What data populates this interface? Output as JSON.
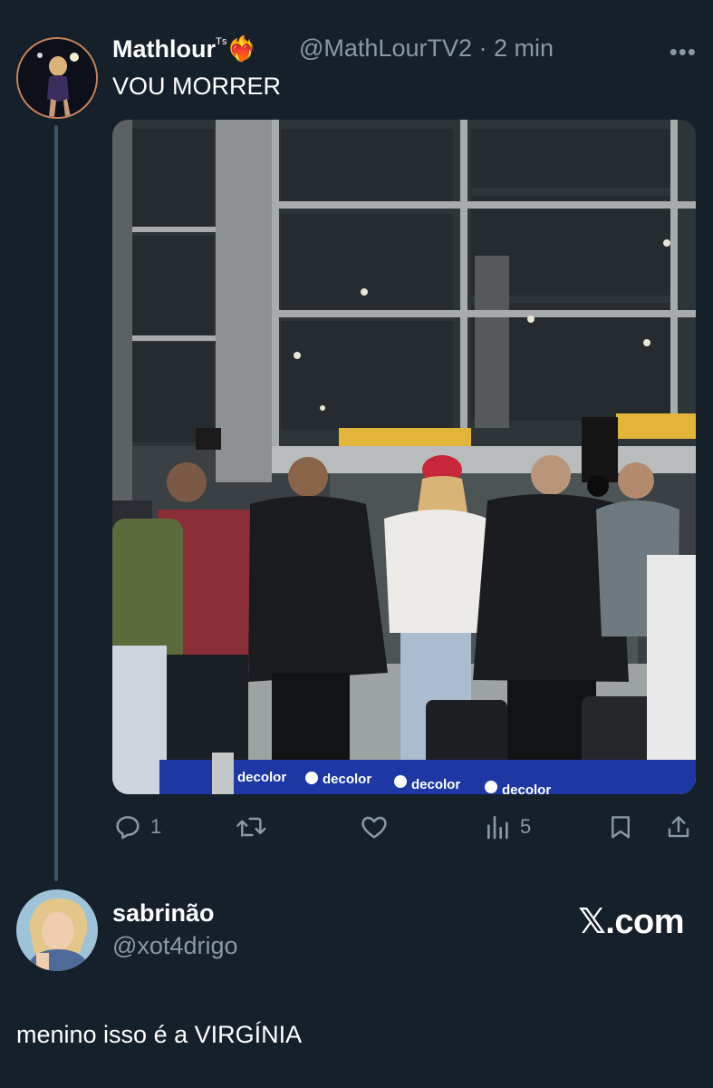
{
  "tweet": {
    "author_name": "Mathlour",
    "author_badge": "ᵀˢ",
    "author_emoji": "❤️‍🔥",
    "handle": "@MathLourTV2",
    "separator": "·",
    "time": "2 min",
    "more": "•••",
    "text": "VOU MORRER",
    "media_signs": {
      "decolor": "decolor"
    },
    "stats": {
      "replies": "1",
      "retweets": "",
      "likes": "",
      "views": "5"
    }
  },
  "reply": {
    "author_name": "sabrinão",
    "handle": "@xot4drigo",
    "text": "menino isso é a VIRGÍNIA"
  },
  "watermark": "𝕏.com",
  "colors": {
    "background": "#15202b",
    "muted": "#8b98a5",
    "thread_line": "#3d5466"
  },
  "icons": [
    "reply-icon",
    "retweet-icon",
    "like-icon",
    "views-icon",
    "bookmark-icon",
    "share-icon",
    "more-icon"
  ]
}
